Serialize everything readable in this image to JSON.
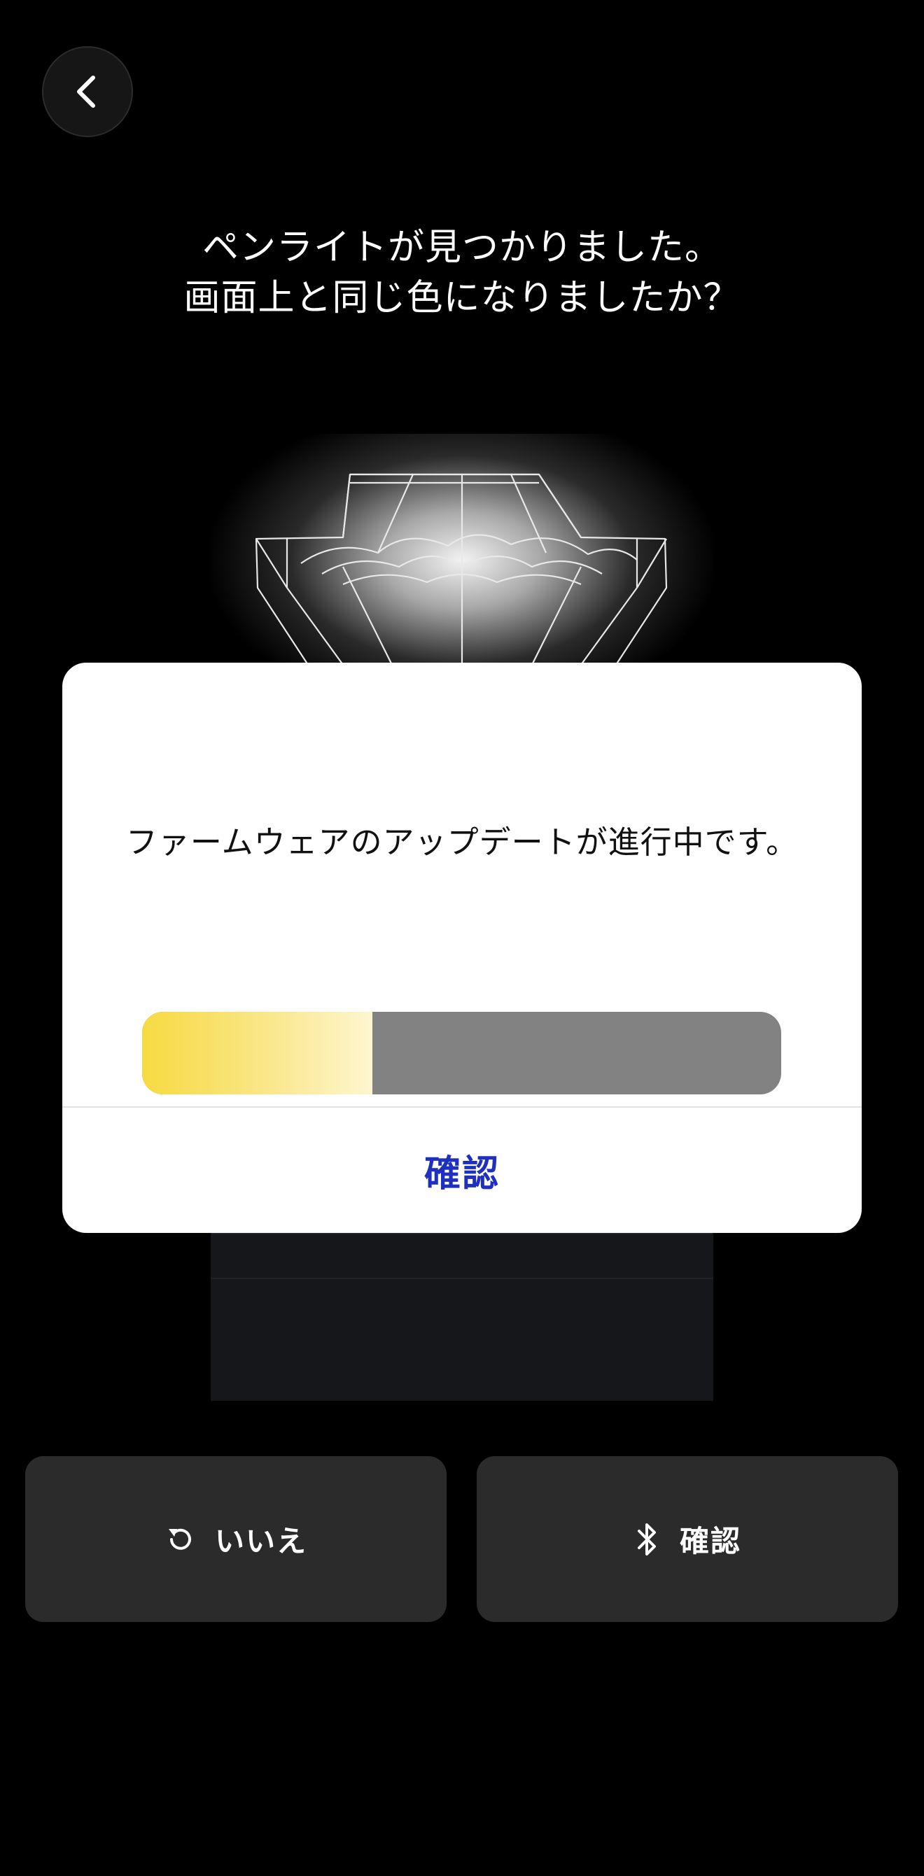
{
  "header": {
    "back_icon": "chevron-left-icon"
  },
  "prompt": {
    "line1": "ペンライトが見つかりました。",
    "line2": "画面上と同じ色になりましたか？"
  },
  "modal": {
    "message": "ファームウェアのアップデートが進行中です。",
    "progress": 0.36,
    "progress_color": "#f7da42",
    "confirm_label": "確認",
    "confirm_color": "#1f2fc0"
  },
  "actions": {
    "no": {
      "label": "いいえ",
      "icon": "refresh-icon"
    },
    "yes": {
      "label": "確認",
      "icon": "bluetooth-icon"
    }
  }
}
